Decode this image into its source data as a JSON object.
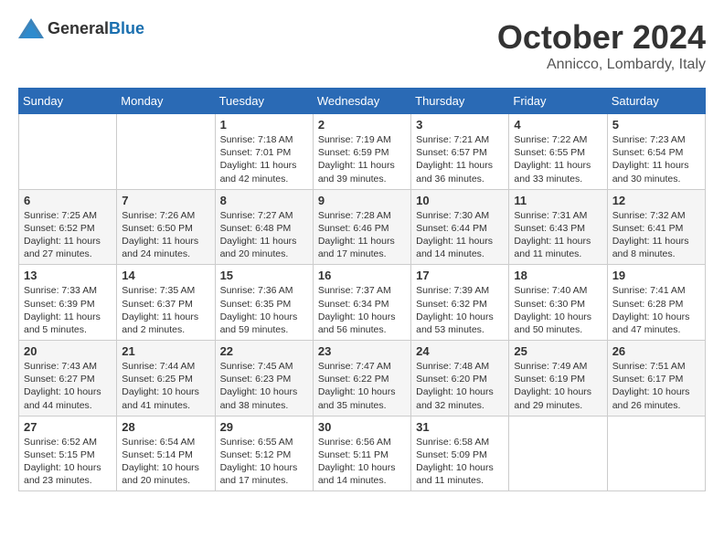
{
  "header": {
    "logo_general": "General",
    "logo_blue": "Blue",
    "month_year": "October 2024",
    "location": "Annicco, Lombardy, Italy"
  },
  "days_of_week": [
    "Sunday",
    "Monday",
    "Tuesday",
    "Wednesday",
    "Thursday",
    "Friday",
    "Saturday"
  ],
  "weeks": [
    [
      {
        "day": "",
        "sunrise": "",
        "sunset": "",
        "daylight": ""
      },
      {
        "day": "",
        "sunrise": "",
        "sunset": "",
        "daylight": ""
      },
      {
        "day": "1",
        "sunrise": "Sunrise: 7:18 AM",
        "sunset": "Sunset: 7:01 PM",
        "daylight": "Daylight: 11 hours and 42 minutes."
      },
      {
        "day": "2",
        "sunrise": "Sunrise: 7:19 AM",
        "sunset": "Sunset: 6:59 PM",
        "daylight": "Daylight: 11 hours and 39 minutes."
      },
      {
        "day": "3",
        "sunrise": "Sunrise: 7:21 AM",
        "sunset": "Sunset: 6:57 PM",
        "daylight": "Daylight: 11 hours and 36 minutes."
      },
      {
        "day": "4",
        "sunrise": "Sunrise: 7:22 AM",
        "sunset": "Sunset: 6:55 PM",
        "daylight": "Daylight: 11 hours and 33 minutes."
      },
      {
        "day": "5",
        "sunrise": "Sunrise: 7:23 AM",
        "sunset": "Sunset: 6:54 PM",
        "daylight": "Daylight: 11 hours and 30 minutes."
      }
    ],
    [
      {
        "day": "6",
        "sunrise": "Sunrise: 7:25 AM",
        "sunset": "Sunset: 6:52 PM",
        "daylight": "Daylight: 11 hours and 27 minutes."
      },
      {
        "day": "7",
        "sunrise": "Sunrise: 7:26 AM",
        "sunset": "Sunset: 6:50 PM",
        "daylight": "Daylight: 11 hours and 24 minutes."
      },
      {
        "day": "8",
        "sunrise": "Sunrise: 7:27 AM",
        "sunset": "Sunset: 6:48 PM",
        "daylight": "Daylight: 11 hours and 20 minutes."
      },
      {
        "day": "9",
        "sunrise": "Sunrise: 7:28 AM",
        "sunset": "Sunset: 6:46 PM",
        "daylight": "Daylight: 11 hours and 17 minutes."
      },
      {
        "day": "10",
        "sunrise": "Sunrise: 7:30 AM",
        "sunset": "Sunset: 6:44 PM",
        "daylight": "Daylight: 11 hours and 14 minutes."
      },
      {
        "day": "11",
        "sunrise": "Sunrise: 7:31 AM",
        "sunset": "Sunset: 6:43 PM",
        "daylight": "Daylight: 11 hours and 11 minutes."
      },
      {
        "day": "12",
        "sunrise": "Sunrise: 7:32 AM",
        "sunset": "Sunset: 6:41 PM",
        "daylight": "Daylight: 11 hours and 8 minutes."
      }
    ],
    [
      {
        "day": "13",
        "sunrise": "Sunrise: 7:33 AM",
        "sunset": "Sunset: 6:39 PM",
        "daylight": "Daylight: 11 hours and 5 minutes."
      },
      {
        "day": "14",
        "sunrise": "Sunrise: 7:35 AM",
        "sunset": "Sunset: 6:37 PM",
        "daylight": "Daylight: 11 hours and 2 minutes."
      },
      {
        "day": "15",
        "sunrise": "Sunrise: 7:36 AM",
        "sunset": "Sunset: 6:35 PM",
        "daylight": "Daylight: 10 hours and 59 minutes."
      },
      {
        "day": "16",
        "sunrise": "Sunrise: 7:37 AM",
        "sunset": "Sunset: 6:34 PM",
        "daylight": "Daylight: 10 hours and 56 minutes."
      },
      {
        "day": "17",
        "sunrise": "Sunrise: 7:39 AM",
        "sunset": "Sunset: 6:32 PM",
        "daylight": "Daylight: 10 hours and 53 minutes."
      },
      {
        "day": "18",
        "sunrise": "Sunrise: 7:40 AM",
        "sunset": "Sunset: 6:30 PM",
        "daylight": "Daylight: 10 hours and 50 minutes."
      },
      {
        "day": "19",
        "sunrise": "Sunrise: 7:41 AM",
        "sunset": "Sunset: 6:28 PM",
        "daylight": "Daylight: 10 hours and 47 minutes."
      }
    ],
    [
      {
        "day": "20",
        "sunrise": "Sunrise: 7:43 AM",
        "sunset": "Sunset: 6:27 PM",
        "daylight": "Daylight: 10 hours and 44 minutes."
      },
      {
        "day": "21",
        "sunrise": "Sunrise: 7:44 AM",
        "sunset": "Sunset: 6:25 PM",
        "daylight": "Daylight: 10 hours and 41 minutes."
      },
      {
        "day": "22",
        "sunrise": "Sunrise: 7:45 AM",
        "sunset": "Sunset: 6:23 PM",
        "daylight": "Daylight: 10 hours and 38 minutes."
      },
      {
        "day": "23",
        "sunrise": "Sunrise: 7:47 AM",
        "sunset": "Sunset: 6:22 PM",
        "daylight": "Daylight: 10 hours and 35 minutes."
      },
      {
        "day": "24",
        "sunrise": "Sunrise: 7:48 AM",
        "sunset": "Sunset: 6:20 PM",
        "daylight": "Daylight: 10 hours and 32 minutes."
      },
      {
        "day": "25",
        "sunrise": "Sunrise: 7:49 AM",
        "sunset": "Sunset: 6:19 PM",
        "daylight": "Daylight: 10 hours and 29 minutes."
      },
      {
        "day": "26",
        "sunrise": "Sunrise: 7:51 AM",
        "sunset": "Sunset: 6:17 PM",
        "daylight": "Daylight: 10 hours and 26 minutes."
      }
    ],
    [
      {
        "day": "27",
        "sunrise": "Sunrise: 6:52 AM",
        "sunset": "Sunset: 5:15 PM",
        "daylight": "Daylight: 10 hours and 23 minutes."
      },
      {
        "day": "28",
        "sunrise": "Sunrise: 6:54 AM",
        "sunset": "Sunset: 5:14 PM",
        "daylight": "Daylight: 10 hours and 20 minutes."
      },
      {
        "day": "29",
        "sunrise": "Sunrise: 6:55 AM",
        "sunset": "Sunset: 5:12 PM",
        "daylight": "Daylight: 10 hours and 17 minutes."
      },
      {
        "day": "30",
        "sunrise": "Sunrise: 6:56 AM",
        "sunset": "Sunset: 5:11 PM",
        "daylight": "Daylight: 10 hours and 14 minutes."
      },
      {
        "day": "31",
        "sunrise": "Sunrise: 6:58 AM",
        "sunset": "Sunset: 5:09 PM",
        "daylight": "Daylight: 10 hours and 11 minutes."
      },
      {
        "day": "",
        "sunrise": "",
        "sunset": "",
        "daylight": ""
      },
      {
        "day": "",
        "sunrise": "",
        "sunset": "",
        "daylight": ""
      }
    ]
  ]
}
